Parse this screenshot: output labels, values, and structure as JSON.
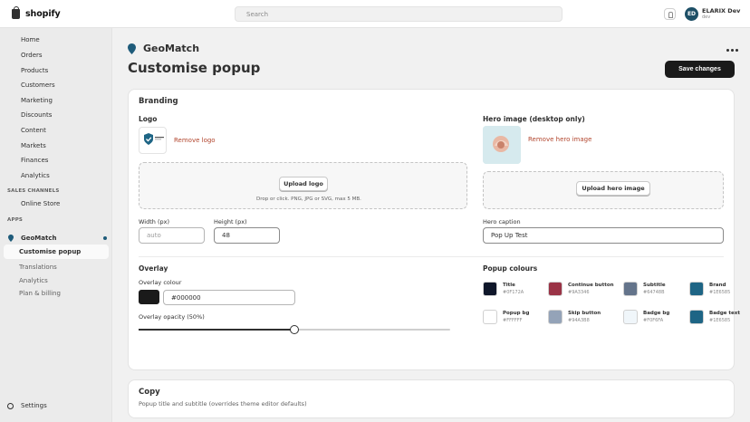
{
  "topbar": {
    "brand": "shopify",
    "search_placeholder": "Search",
    "avatar_initials": "ED",
    "user_name": "ELARIX Dev",
    "user_role": "dev"
  },
  "sidebar": {
    "items": [
      "Home",
      "Orders",
      "Products",
      "Customers",
      "Marketing",
      "Discounts",
      "Content",
      "Markets",
      "Finances",
      "Analytics"
    ],
    "sales_channels_heading": "SALES CHANNELS",
    "sales_channels": [
      "Online Store"
    ],
    "apps_heading": "APPS",
    "app_name": "GeoMatch",
    "app_subitems": [
      "Customise popup",
      "Translations",
      "Analytics",
      "Plan & billing"
    ],
    "active_subitem": "Customise popup",
    "settings": "Settings"
  },
  "page": {
    "app_name": "GeoMatch",
    "title": "Customise popup",
    "save_label": "Save changes"
  },
  "branding": {
    "title": "Branding",
    "logo_heading": "Logo",
    "logo_remove": "Remove logo",
    "logo_upload": "Upload logo",
    "logo_hint": "Drop or click. PNG, JPG or SVG, max 5 MB.",
    "width_label": "Width (px)",
    "width_placeholder": "auto",
    "height_label": "Height (px)",
    "height_value": "48",
    "hero_heading": "Hero image (desktop only)",
    "hero_remove": "Remove hero image",
    "hero_upload": "Upload hero image",
    "hero_caption_label": "Hero caption",
    "hero_caption_value": "Pop Up Test",
    "overlay_heading": "Overlay",
    "overlay_colour_label": "Overlay colour",
    "overlay_colour_value": "#000000",
    "overlay_opacity_label": "Overlay opacity (50%)",
    "overlay_opacity": 0.5,
    "popup_colours_heading": "Popup colours",
    "swatches": [
      {
        "name": "Title",
        "hex": "#0F172A"
      },
      {
        "name": "Continue button",
        "hex": "#9A3346"
      },
      {
        "name": "Subtitle",
        "hex": "#64748B"
      },
      {
        "name": "Brand",
        "hex": "#1E6585"
      },
      {
        "name": "Popup bg",
        "hex": "#FFFFFF"
      },
      {
        "name": "Skip button",
        "hex": "#94A3B8"
      },
      {
        "name": "Badge bg",
        "hex": "#F0F6FA"
      },
      {
        "name": "Badge text",
        "hex": "#1E6585"
      }
    ]
  },
  "copy": {
    "title": "Copy",
    "subtitle": "Popup title and subtitle (overrides theme editor defaults)"
  },
  "colors": {
    "app_pin": "#1e5b7a",
    "remove_link": "#b2462e",
    "primary_button": "#1a1a1a"
  }
}
